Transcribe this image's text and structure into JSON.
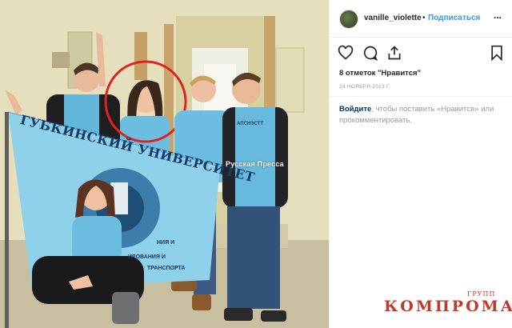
{
  "post": {
    "username": "vanille_violette",
    "separator": "•",
    "follow_label": "Подписаться",
    "more_label": "...",
    "likes_text": "8 отметок \"Нравится\"",
    "date_text": "24 НОЯБРЯ 2013 Г.",
    "login_link": "Войдите",
    "login_rest": ", чтобы поставить «Нравится» или прокомментировать."
  },
  "photo": {
    "banner_line1": "ГУБКИНСКИЙ УНИВЕРСИТЕТ",
    "banner_line2": "НИЯ И",
    "banner_line3": "ИРОВАНИЯ И",
    "banner_line4": "ТРАНСПОРТА",
    "shirt_text": "АПСНЭСТТ",
    "press_watermark": "Русская Пресса",
    "highlight_circle_color": "#e0231d"
  },
  "watermark": {
    "main": "КОМПРОМАТ",
    "sub": "ГРУПП"
  },
  "icons": {
    "like": "heart-icon",
    "comment": "comment-icon",
    "share": "share-icon",
    "save": "bookmark-icon"
  }
}
